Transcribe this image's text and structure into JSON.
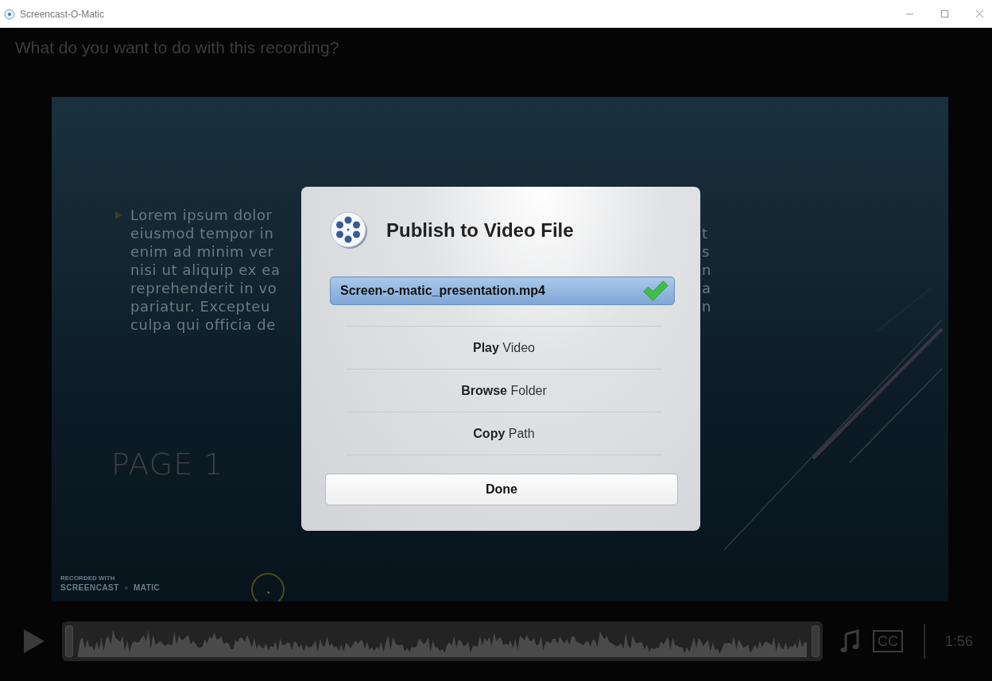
{
  "window": {
    "title": "Screencast-O-Matic"
  },
  "prompt": "What do you want to do with this recording?",
  "slide": {
    "left_lines": [
      "Lorem ipsum dolor",
      "eiusmod tempor in",
      "enim ad minim ver",
      "nisi ut aliquip ex ea",
      "reprehenderit in vo",
      "pariatur. Excepteu",
      "culpa qui officia de"
    ],
    "right_fragments": [
      "t",
      "s",
      "n",
      "a",
      "n"
    ],
    "page_label": "PAGE 1",
    "logo": {
      "caption": "RECORDED WITH",
      "left": "SCREENCAST",
      "right": "MATIC"
    }
  },
  "dialog": {
    "title": "Publish to Video File",
    "filename": "Screen-o-matic_presentation.mp4",
    "saved": true,
    "options": [
      "**Play** Video",
      "**Browse** Folder",
      "**Copy** Path"
    ],
    "done": "Done"
  },
  "player": {
    "cc": "CC",
    "time": "1:56"
  }
}
